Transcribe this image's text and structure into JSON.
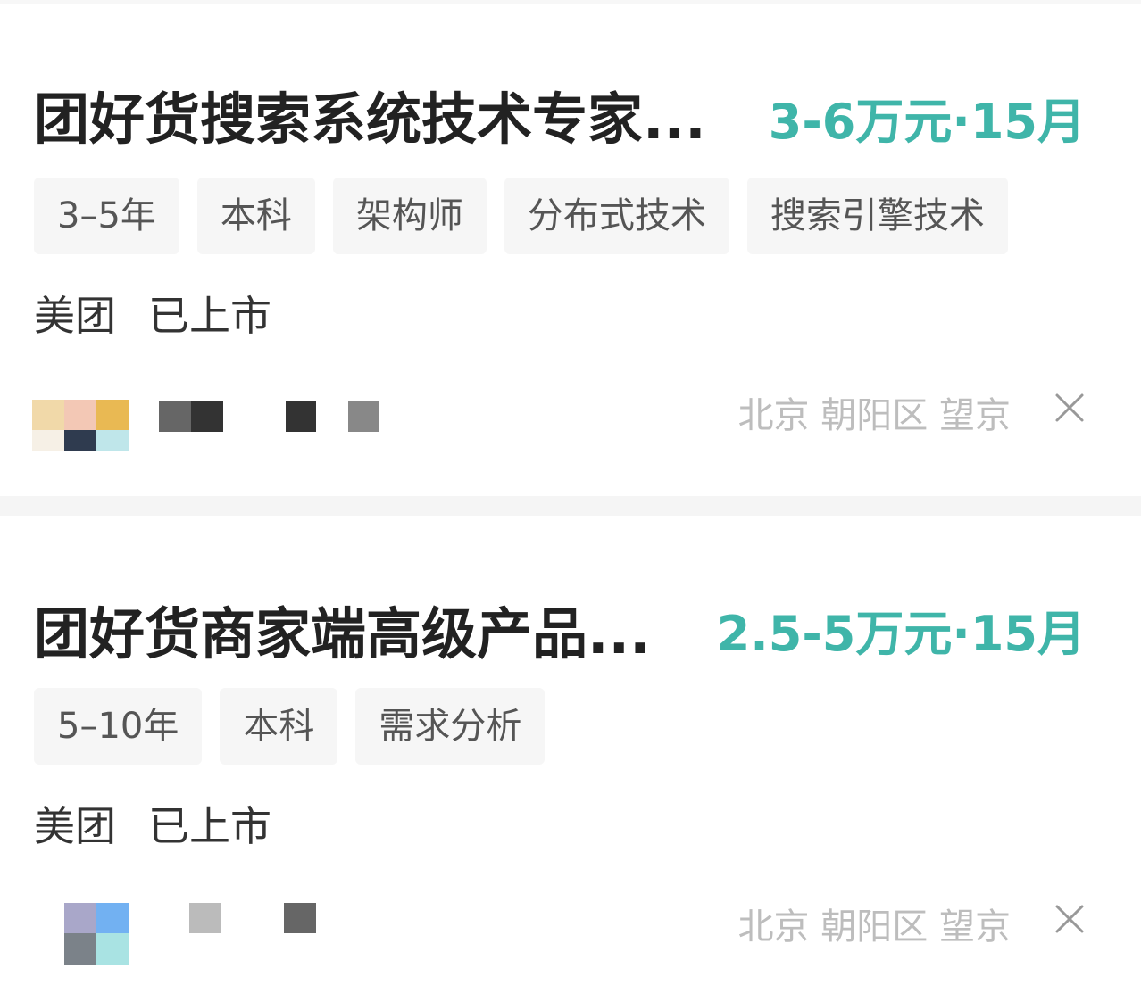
{
  "jobs": [
    {
      "title": "团好货搜索系统技术专家...",
      "salary": "3-6万元·15月",
      "tags": [
        "3–5年",
        "本科",
        "架构师",
        "分布式技术",
        "搜索引擎技术"
      ],
      "company": "美团",
      "company_status": "已上市",
      "location": "北京 朝阳区 望京",
      "avatar_icon": "blurred-avatar-icon",
      "close_icon": "close-icon"
    },
    {
      "title": "团好货商家端高级产品...",
      "salary": "2.5-5万元·15月",
      "tags": [
        "5–10年",
        "本科",
        "需求分析"
      ],
      "company": "美团",
      "company_status": "已上市",
      "location": "北京 朝阳区 望京",
      "avatar_icon": "blurred-avatar-icon",
      "close_icon": "close-icon"
    }
  ],
  "colors": {
    "salary": "#3fb5a9",
    "title": "#222222",
    "tag_bg": "#f6f6f6",
    "location": "#bdbdbd"
  }
}
